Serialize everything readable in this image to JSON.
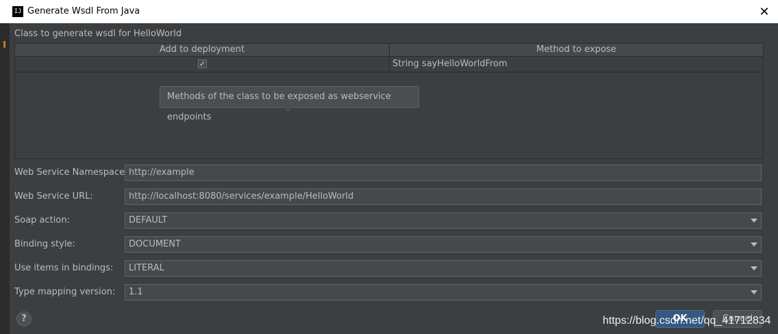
{
  "window": {
    "title": "Generate Wsdl From Java",
    "app_icon": "intellij-icon",
    "close_glyph": "✕"
  },
  "class_label": "Class to generate wsdl for HelloWorld",
  "table": {
    "columns": [
      "Add to deployment",
      "Method to expose"
    ],
    "rows": [
      {
        "add_to_deployment": true,
        "check_glyph": "✓",
        "method": "String sayHelloWorldFrom"
      }
    ]
  },
  "tooltip": "Methods of the class to be exposed as webservice endpoints",
  "form": {
    "namespace": {
      "label": "Web Service Namespace:",
      "value": "http://example"
    },
    "url": {
      "label": "Web Service URL:",
      "value": "http://localhost:8080/services/example/HelloWorld"
    },
    "soap_action": {
      "label": "Soap action:",
      "value": "DEFAULT"
    },
    "binding_style": {
      "label": "Binding style:",
      "value": "DOCUMENT"
    },
    "use_items": {
      "label": "Use items in bindings:",
      "value": "LITERAL"
    },
    "type_mapping": {
      "label": "Type mapping version:",
      "value": "1.1"
    }
  },
  "buttons": {
    "help": "?",
    "ok": "OK",
    "cancel": "Cancel"
  },
  "watermark": "https://blog.csdn.net/qq_41712834",
  "colors": {
    "background": "#3c3f41",
    "ok_button": "#365880",
    "text": "#bbbbbb"
  }
}
